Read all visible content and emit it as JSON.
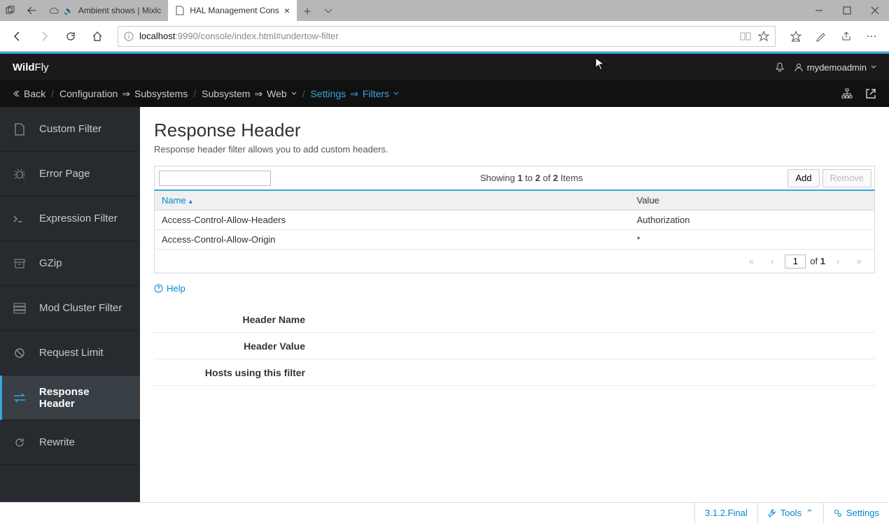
{
  "browser": {
    "tabs": [
      {
        "title": "Ambient shows | Mixlc",
        "active": false,
        "fav": "cloud"
      },
      {
        "title": "HAL Management Cons",
        "active": true,
        "fav": "page"
      }
    ],
    "url_host": "localhost",
    "url_port": ":9990",
    "url_path": "/console/index.html#undertow-filter"
  },
  "brand": {
    "bold": "Wild",
    "light": "Fly"
  },
  "user": {
    "name": "mydemoadmin"
  },
  "breadcrumb": {
    "back": "Back",
    "items": [
      {
        "label": "Configuration",
        "arrow": true
      },
      {
        "label": "Subsystems"
      },
      {
        "label2": "Subsystem",
        "arrow": true,
        "label": "Web",
        "dd": true
      },
      {
        "label2": "Settings",
        "arrow": true,
        "label": "Filters",
        "dd": true,
        "link": true
      }
    ]
  },
  "sidebar": {
    "items": [
      {
        "label": "Custom Filter",
        "icon": "file"
      },
      {
        "label": "Error Page",
        "icon": "bug"
      },
      {
        "label": "Expression Filter",
        "icon": "terminal"
      },
      {
        "label": "GZip",
        "icon": "archive"
      },
      {
        "label": "Mod Cluster Filter",
        "icon": "servers"
      },
      {
        "label": "Request Limit",
        "icon": "ban"
      },
      {
        "label": "Response Header",
        "icon": "exchange",
        "active": true
      },
      {
        "label": "Rewrite",
        "icon": "refresh"
      }
    ]
  },
  "page": {
    "title": "Response Header",
    "desc": "Response header filter allows you to add custom headers.",
    "showing_static_a": "Showing ",
    "showing_a": "1",
    "showing_to": " to ",
    "showing_b": "2",
    "showing_of": " of ",
    "showing_c": "2",
    "showing_items": " Items",
    "add": "Add",
    "remove": "Remove",
    "columns": {
      "name": "Name",
      "value": "Value"
    },
    "rows": [
      {
        "name": "Access-Control-Allow-Headers",
        "value": "Authorization"
      },
      {
        "name": "Access-Control-Allow-Origin",
        "value": "*"
      }
    ],
    "pager": {
      "page": "1",
      "of": "of",
      "total": "1"
    },
    "help": "Help",
    "form": {
      "r0": "Header Name",
      "r1": "Header Value",
      "r2": "Hosts using this filter"
    }
  },
  "footer": {
    "version": "3.1.2.Final",
    "tools": "Tools",
    "settings": "Settings"
  }
}
